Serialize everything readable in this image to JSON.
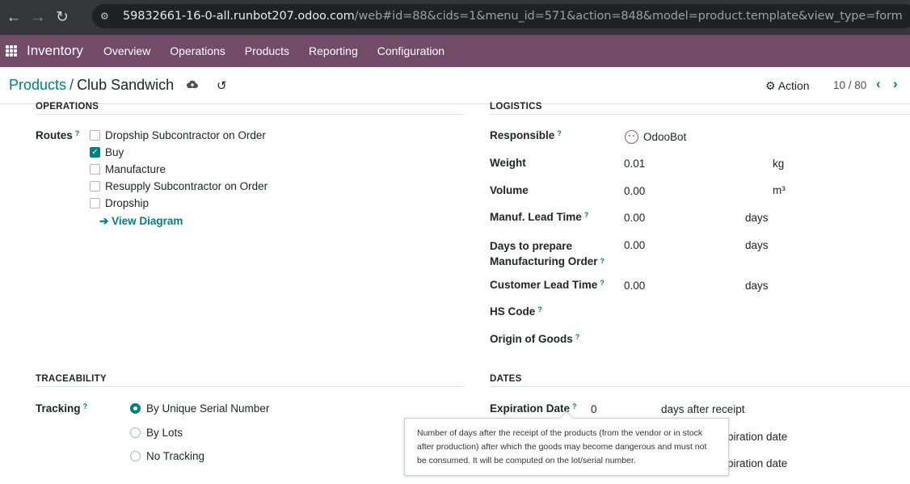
{
  "browser": {
    "url_domain": "59832661-16-0-all.runbot207.odoo.com",
    "url_path": "/web#id=88&cids=1&menu_id=571&action=848&model=product.template&view_type=form"
  },
  "navbar": {
    "app_name": "Inventory",
    "menu": [
      "Overview",
      "Operations",
      "Products",
      "Reporting",
      "Configuration"
    ]
  },
  "control_panel": {
    "breadcrumb_parent": "Products",
    "breadcrumb_sep": "/",
    "record_name": "Club Sandwich",
    "action_label": "Action",
    "pager": "10 / 80"
  },
  "operations": {
    "title": "OPERATIONS",
    "routes_label": "Routes",
    "routes": [
      {
        "label": "Dropship Subcontractor on Order",
        "checked": false
      },
      {
        "label": "Buy",
        "checked": true
      },
      {
        "label": "Manufacture",
        "checked": false
      },
      {
        "label": "Resupply Subcontractor on Order",
        "checked": false
      },
      {
        "label": "Dropship",
        "checked": false
      }
    ],
    "view_diagram": "View Diagram"
  },
  "logistics": {
    "title": "LOGISTICS",
    "responsible_label": "Responsible",
    "responsible_value": "OdooBot",
    "weight_label": "Weight",
    "weight_value": "0.01",
    "weight_unit": "kg",
    "volume_label": "Volume",
    "volume_value": "0.00",
    "volume_unit": "m³",
    "manuf_lead_label": "Manuf. Lead Time",
    "manuf_lead_value": "0.00",
    "manuf_lead_unit": "days",
    "days_prepare_label_1": "Days to prepare",
    "days_prepare_label_2": "Manufacturing Order",
    "days_prepare_value": "0.00",
    "days_prepare_unit": "days",
    "customer_lead_label": "Customer Lead Time",
    "customer_lead_value": "0.00",
    "customer_lead_unit": "days",
    "hs_code_label": "HS Code",
    "origin_label": "Origin of Goods"
  },
  "traceability": {
    "title": "TRACEABILITY",
    "tracking_label": "Tracking",
    "options": [
      {
        "label": "By Unique Serial Number",
        "checked": true
      },
      {
        "label": "By Lots",
        "checked": false
      },
      {
        "label": "No Tracking",
        "checked": false
      }
    ]
  },
  "dates": {
    "title": "DATES",
    "expiration_label": "Expiration Date",
    "expiration_value": "0",
    "expiration_unit": "days after receipt",
    "partial_1": "piration date",
    "partial_2": "piration date"
  },
  "tooltip": {
    "text": "Number of days after the receipt of the products (from the vendor or in stock after production) after which the goods may become dangerous and must not be consumed. It will be computed on the lot/serial number."
  },
  "help_mark": "?",
  "colors": {
    "brand": "#714b67",
    "accent": "#017e84"
  }
}
